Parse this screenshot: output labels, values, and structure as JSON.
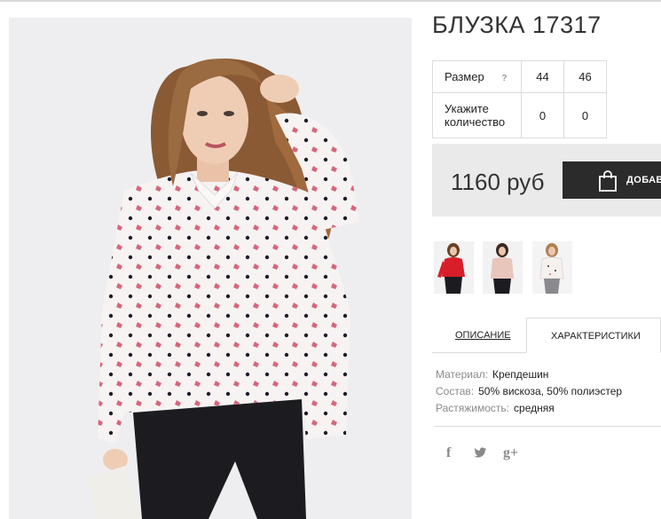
{
  "product": {
    "title": "БЛУЗКА 17317",
    "price": "1160 руб",
    "add_button_label": "ДОБАВ",
    "colors": {
      "button_bg": "#2b2b2b",
      "band_bg": "#eaeaea",
      "thumb_red": "#d81e28",
      "thumb_pink": "#e8c6bc",
      "thumb_white": "#f4f1ee"
    }
  },
  "size_table": {
    "size_label": "Размер",
    "help_icon": "?",
    "sizes": [
      "44",
      "46"
    ],
    "quantity_label_line1": "Укажите",
    "quantity_label_line2": "количество",
    "quantities": [
      "0",
      "0"
    ]
  },
  "thumbnails": [
    {
      "icon": "product-thumbnail-red"
    },
    {
      "icon": "product-thumbnail-pink"
    },
    {
      "icon": "product-thumbnail-white"
    }
  ],
  "tabs": {
    "description": "ОПИСАНИЕ",
    "characteristics": "ХАРАКТЕРИСТИКИ"
  },
  "characteristics": [
    {
      "key": "Материал:",
      "value": "Крепдешин"
    },
    {
      "key": "Состав:",
      "value": "50% вискоза, 50% полиэстер"
    },
    {
      "key": "Растяжимость:",
      "value": "средняя"
    }
  ],
  "social": {
    "facebook": "f",
    "twitter": "twitter-icon",
    "google_plus": "g+"
  }
}
